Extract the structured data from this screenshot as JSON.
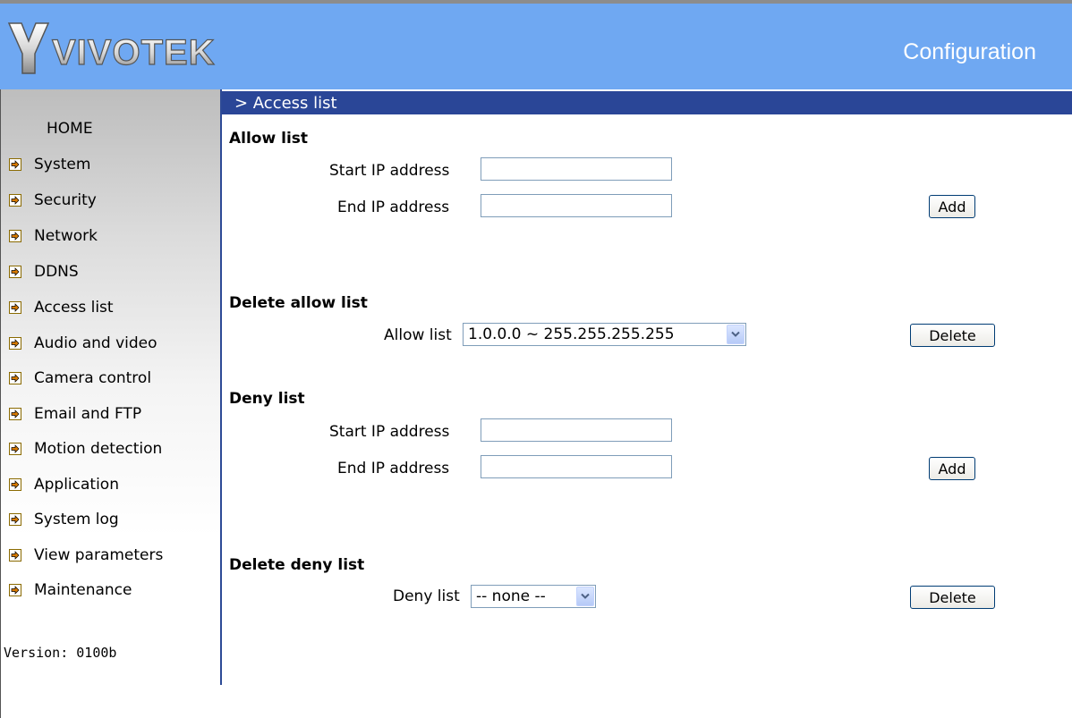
{
  "header": {
    "brand": "VIVOTEK",
    "title": "Configuration"
  },
  "sidebar": {
    "home_label": "HOME",
    "items": [
      {
        "label": "System"
      },
      {
        "label": "Security"
      },
      {
        "label": "Network"
      },
      {
        "label": "DDNS"
      },
      {
        "label": "Access list"
      },
      {
        "label": "Audio and video"
      },
      {
        "label": "Camera control"
      },
      {
        "label": "Email and FTP"
      },
      {
        "label": "Motion detection"
      },
      {
        "label": "Application"
      },
      {
        "label": "System log"
      },
      {
        "label": "View parameters"
      },
      {
        "label": "Maintenance"
      }
    ],
    "version_text": "Version: 0100b"
  },
  "page": {
    "title": "> Access list"
  },
  "allow_list": {
    "heading": "Allow list",
    "start_label": "Start IP address",
    "start_value": "",
    "end_label": "End IP address",
    "end_value": "",
    "add_label": "Add"
  },
  "delete_allow": {
    "heading": "Delete allow list",
    "select_label": "Allow list",
    "selected": "1.0.0.0 ~ 255.255.255.255",
    "delete_label": "Delete"
  },
  "deny_list": {
    "heading": "Deny list",
    "start_label": "Start IP address",
    "start_value": "",
    "end_label": "End IP address",
    "end_value": "",
    "add_label": "Add"
  },
  "delete_deny": {
    "heading": "Delete deny list",
    "select_label": "Deny list",
    "selected": "-- none --",
    "delete_label": "Delete"
  },
  "colors": {
    "header_bg": "#6fa8f2",
    "title_bar_bg": "#2a4697",
    "sidebar_border": "#2d4a96",
    "nav_arrow": "#d87a00"
  }
}
